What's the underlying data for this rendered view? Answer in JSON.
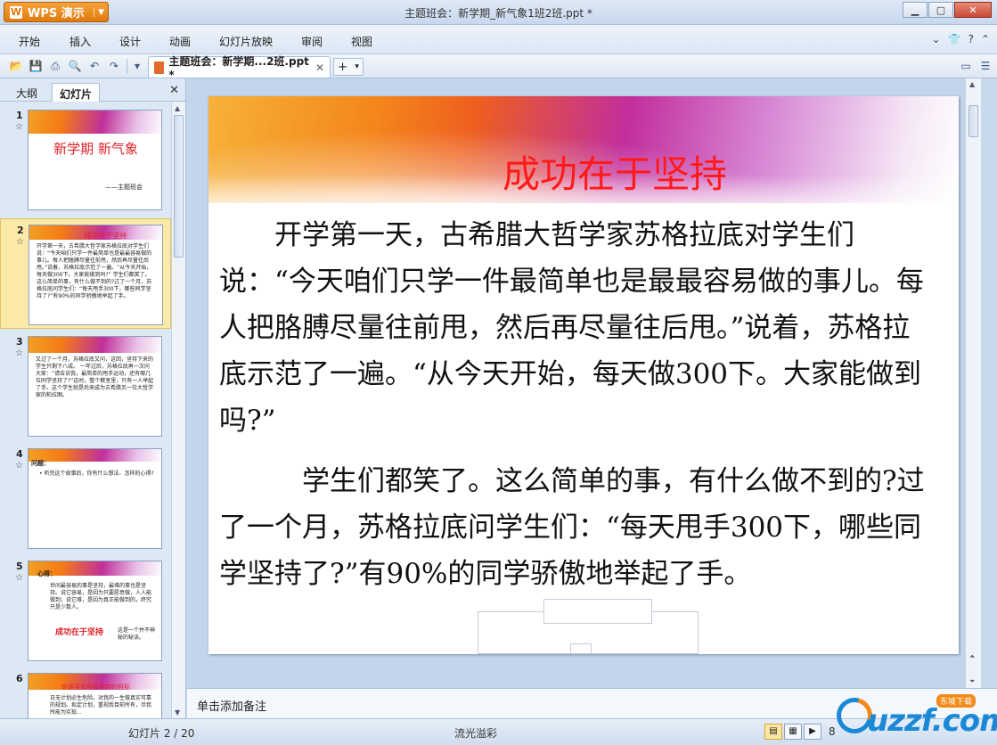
{
  "app": {
    "name": "WPS 演示",
    "logo": "W",
    "window_title": "主题班会：新学期_新气象1班2班.ppt *"
  },
  "menu": [
    "开始",
    "插入",
    "设计",
    "动画",
    "幻灯片放映",
    "审阅",
    "视图"
  ],
  "doc_tab": {
    "label": "主题班会：新学期...2班.ppt *"
  },
  "left_panel": {
    "tabs": [
      "大纲",
      "幻灯片"
    ],
    "thumbnails": [
      {
        "num": "1",
        "title": "新学期 新气象",
        "sub": "——主题班会"
      },
      {
        "num": "2",
        "title": "成功在于坚持",
        "text": "开学第一天，古希腊大哲学家苏格拉底对学生们说：“今天咱们只学一件最简单也是最最容易做的事儿。每人把胳膊尽量往前甩，然后再尽量往后甩。”说着，苏格拉底示范了一遍。“从今天开始，每天做300下。大家能做到吗?” 学生们都笑了。这么简单的事，有什么做不到的?过了一个月，苏格拉底问学生们：“每天甩手300下，哪些同学坚持了?”有90%的同学骄傲地举起了手。"
      },
      {
        "num": "3",
        "text": "又过了一个月，苏格拉底又问，这回，坚持下来的学生只剩下八成。 一年过后，苏格拉底再一次问大家：“请告诉我，最简单的甩手运动，还有哪几位同学坚持了?”这时，整个教室里，只有一人举起了手。这个学生就是后来成为古希腊另一位大哲学家的柏拉图。"
      },
      {
        "num": "4",
        "label": "问题：",
        "text": "• 听完这个故事后，你有什么想法、怎样的心得?"
      },
      {
        "num": "5",
        "label": "心得：",
        "text": "世间最容易的事是坚持，最难的事也是坚持。说它容易，是因为只要愿意做，人人能做到；说它难，是因为真正能做到的，终究只是少数人。",
        "highlight": "成功在于坚持",
        "tail": "这是一个并不神秘的秘诀。"
      },
      {
        "num": "6",
        "title": "你是否有自我坚持的目标",
        "text": "日无计划必生危险。对我的一生做真实可靠的规划。拟定计划，重视我目前所有，尽我所能为实现..."
      }
    ]
  },
  "slide": {
    "title": "成功在于坚持",
    "para1": "　　开学第一天，古希腊大哲学家苏格拉底对学生们说：“今天咱们只学一件最简单也是最最容易做的事儿。每人把胳膊尽量往前甩，然后再尽量往后甩。”说着，苏格拉底示范了一遍。“从今天开始，每天做300下。大家能做到吗?”",
    "para2": "　　　学生们都笑了。这么简单的事，有什么做不到的?过了一个月，苏格拉底问学生们：“每天甩手300下，哪些同学坚持了?”有90%的同学骄傲地举起了手。"
  },
  "notes": {
    "placeholder": "单击添加备注"
  },
  "status": {
    "slide_counter": "幻灯片 2 / 20",
    "theme": "流光溢彩",
    "zoom": "8"
  },
  "watermark": {
    "word": "uzzf.com",
    "badge": "东坡下载"
  },
  "colors": {
    "title_red": "#ff1a1a",
    "wps_orange": "#e07a0e",
    "selection": "#fbe9a8"
  }
}
